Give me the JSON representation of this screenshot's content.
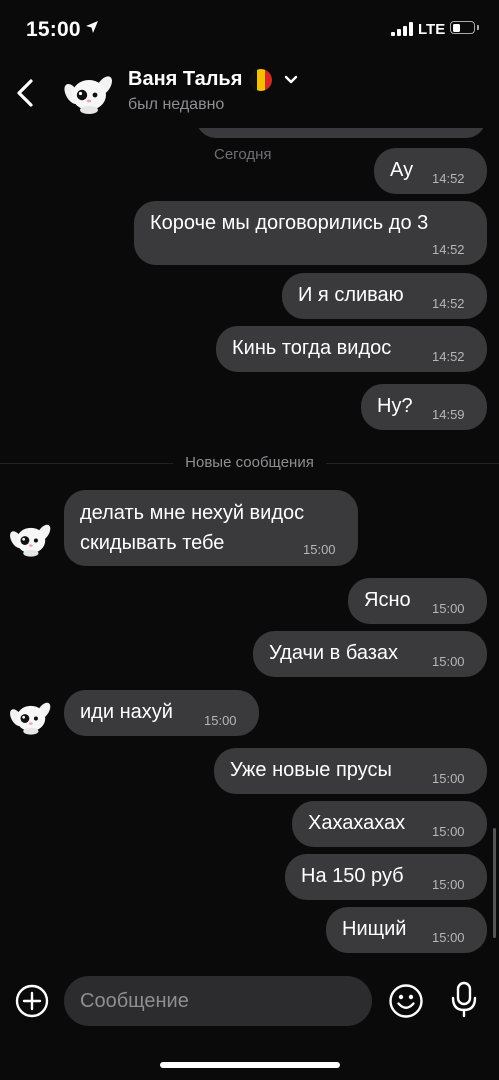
{
  "status_bar": {
    "time": "15:00",
    "network": "LTE"
  },
  "header": {
    "back_icon": "chevron-left-icon",
    "name": "Ваня Талья",
    "flag_colors": [
      "#111111",
      "#f2c200",
      "#d42a20"
    ],
    "status": "был недавно"
  },
  "chat": {
    "date_label": "Сегодня",
    "new_messages_label": "Новые сообщения",
    "messages": [
      {
        "side": "out",
        "text": "Ау",
        "time": "14:52"
      },
      {
        "side": "out",
        "text": "Короче мы договорились до 3",
        "time": "14:52"
      },
      {
        "side": "out",
        "text": "И я сливаю",
        "time": "14:52"
      },
      {
        "side": "out",
        "text": "Кинь тогда видос",
        "time": "14:52"
      },
      {
        "side": "out",
        "text": "Ну?",
        "time": "14:59"
      },
      {
        "side": "in",
        "text": "делать мне нехуй видос",
        "text2": "скидывать тебе",
        "time": "15:00"
      },
      {
        "side": "out",
        "text": "Ясно",
        "time": "15:00"
      },
      {
        "side": "out",
        "text": "Удачи в базах",
        "time": "15:00"
      },
      {
        "side": "in",
        "text": "иди нахуй",
        "time": "15:00"
      },
      {
        "side": "out",
        "text": "Уже новые прусы",
        "time": "15:00"
      },
      {
        "side": "out",
        "text": "Хахахахах",
        "time": "15:00"
      },
      {
        "side": "out",
        "text": "На 150 руб",
        "time": "15:00"
      },
      {
        "side": "out",
        "text": "Нищий",
        "time": "15:00"
      }
    ]
  },
  "composer": {
    "placeholder": "Сообщение",
    "value": ""
  },
  "colors": {
    "background": "#0a0a0a",
    "bubble": "#3a3a3c",
    "input": "#2c2c2e",
    "muted_text": "#8e8e93"
  }
}
